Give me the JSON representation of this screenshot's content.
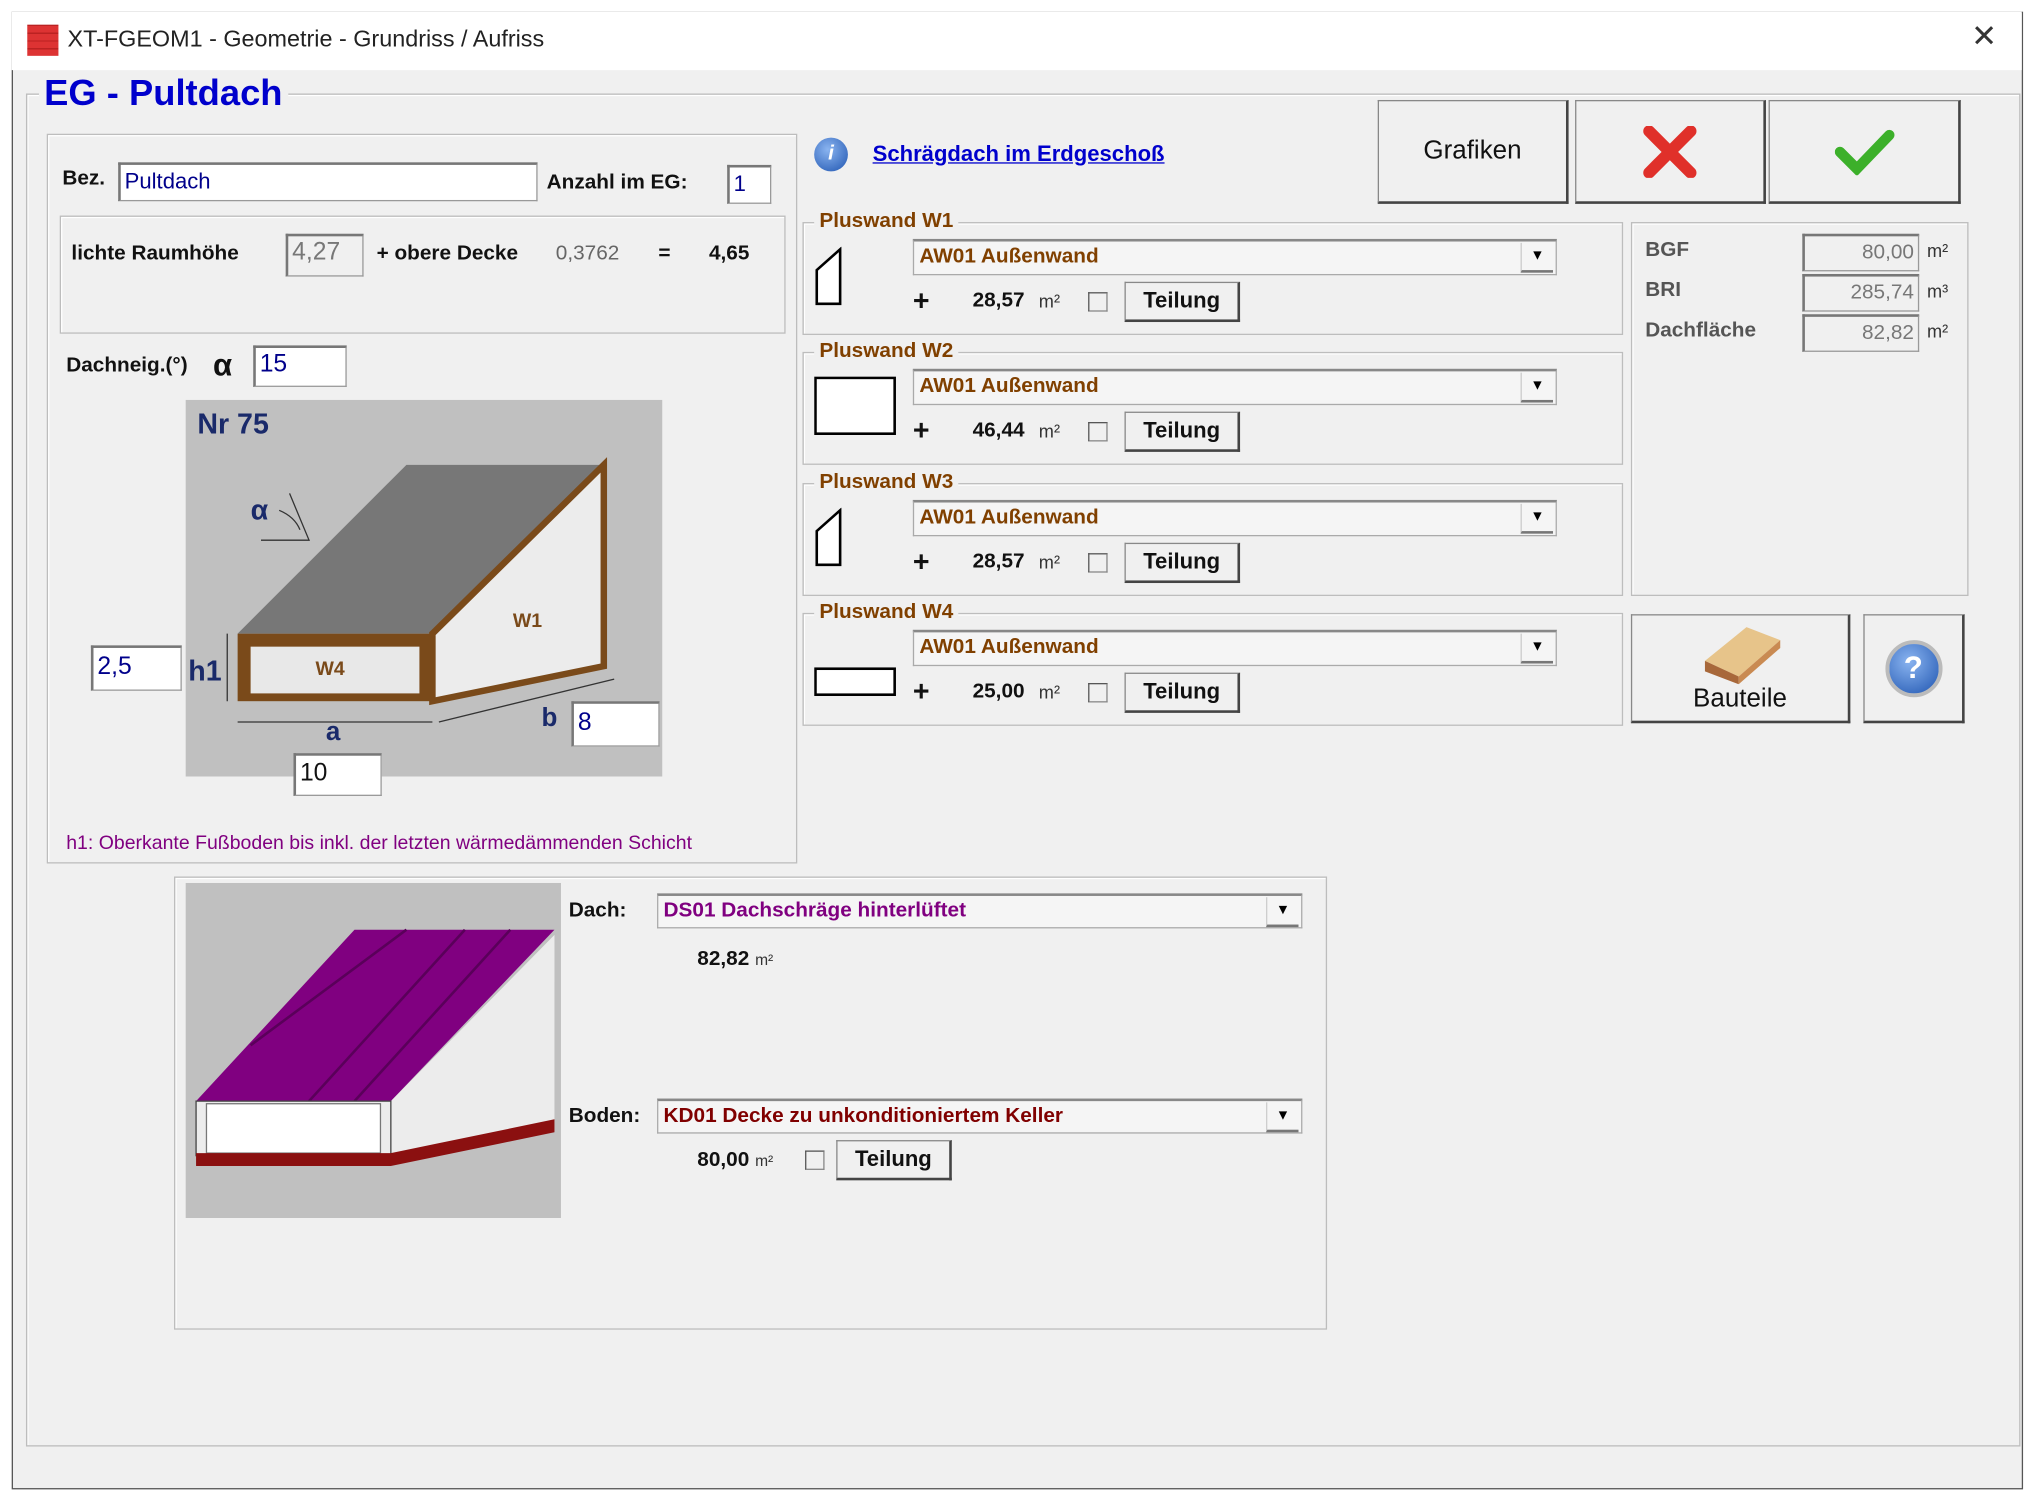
{
  "window": {
    "title": "XT-FGEOM1 - Geometrie - Grundriss / Aufriss",
    "close_icon": "close-icon"
  },
  "section_title": "EG - Pultdach",
  "form": {
    "bez_label": "Bez.",
    "bez_value": "Pultdach",
    "anzahl_label": "Anzahl im EG:",
    "anzahl_value": "1",
    "raumhoehe_label": "lichte Raumhöhe",
    "raumhoehe_value": "4,27",
    "obere_decke_label": "+ obere Decke",
    "obere_decke_value": "0,3762",
    "equals": "=",
    "total_height": "4,65",
    "dachneig_label": "Dachneig.(°)",
    "alpha": "α",
    "dachneig_value": "15",
    "h1_value": "2,5",
    "b_value": "8",
    "a_value": "10",
    "footnote": "h1: Oberkante Fußboden bis inkl. der letzten wärmedämmenden Schicht"
  },
  "diagram": {
    "nr": "Nr 75",
    "alpha": "α",
    "h1": "h1",
    "w4": "W4",
    "w1": "W1",
    "a": "a",
    "b": "b"
  },
  "info": {
    "link": "Schrägdach im Erdgeschoß"
  },
  "buttons": {
    "grafiken": "Grafiken",
    "cancel_icon": "red-x-icon",
    "ok_icon": "green-check-icon",
    "bauteile": "Bauteile",
    "help_icon": "help-icon"
  },
  "walls": [
    {
      "title": "Pluswand  W1",
      "type": "AW01 Außenwand",
      "plus": "+",
      "area": "28,57",
      "unit": "m²",
      "teilung": "Teilung"
    },
    {
      "title": "Pluswand  W2",
      "type": "AW01 Außenwand",
      "plus": "+",
      "area": "46,44",
      "unit": "m²",
      "teilung": "Teilung"
    },
    {
      "title": "Pluswand  W3",
      "type": "AW01 Außenwand",
      "plus": "+",
      "area": "28,57",
      "unit": "m²",
      "teilung": "Teilung"
    },
    {
      "title": "Pluswand  W4",
      "type": "AW01 Außenwand",
      "plus": "+",
      "area": "25,00",
      "unit": "m²",
      "teilung": "Teilung"
    }
  ],
  "stats": [
    {
      "label": "BGF",
      "value": "80,00",
      "unit": "m²"
    },
    {
      "label": "BRI",
      "value": "285,74",
      "unit": "m³"
    },
    {
      "label": "Dachfläche",
      "value": "82,82",
      "unit": "m²"
    }
  ],
  "roof": {
    "dach_label": "Dach:",
    "dach_value": "DS01 Dachschräge hinterlüftet",
    "dach_area": "82,82",
    "dach_unit": "m²",
    "boden_label": "Boden:",
    "boden_value": "KD01 Decke zu unkonditioniertem Keller",
    "boden_area": "80,00",
    "boden_unit": "m²",
    "teilung": "Teilung"
  },
  "colors": {
    "title_blue": "#0000cc",
    "group_title": "#804000",
    "dach_text": "#800080",
    "boden_text": "#800000",
    "roof_purple": "#800080"
  }
}
